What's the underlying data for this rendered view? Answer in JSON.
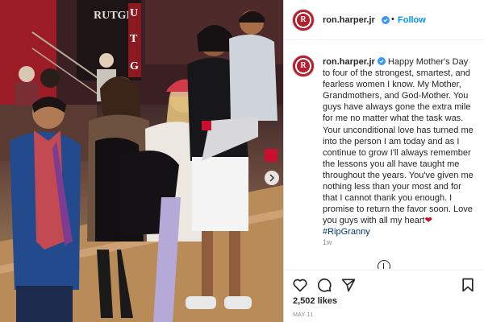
{
  "photo": {
    "alt_label": "",
    "banner_letters": "RUTGE",
    "vertical_letters": [
      "U",
      "T",
      "G"
    ]
  },
  "post": {
    "username": "ron.harper.jr",
    "follow_label": "Follow",
    "separator": "•",
    "caption_body": "Happy Mother's Day to four of the strongest, smartest, and fearless women I know. My Mother, Grandmothers, and God-Mother. You guys have always gone the extra mile for me no matter what the task was. Your unconditional love has turned me into the person I am today and as I continue to grow I'll always remember the lessons you all have taught me throughout the years. You've given me nothing less than your most and for that I cannot thank you enough. I promise to return the favor soon. Love you guys with all my heart",
    "heart_emoji": "❤",
    "hashtag": "#RipGranny",
    "time_ago": "1w",
    "likes": "2,502 likes",
    "date": "MAY 11"
  },
  "colors": {
    "link_blue": "#0095f6",
    "hashtag": "#00376b",
    "muted": "#8e8e8e",
    "avatar_red": "#b51f2e"
  },
  "icons": [
    "verified-badge-icon",
    "heart-icon",
    "comment-icon",
    "share-icon",
    "bookmark-icon",
    "more-icon",
    "carousel-next-icon"
  ]
}
